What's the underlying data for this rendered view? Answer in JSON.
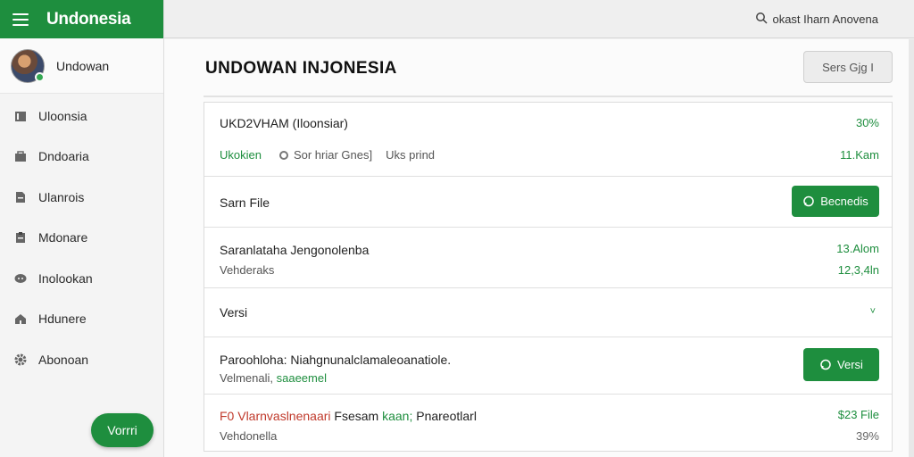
{
  "app": {
    "brand": "Undonesia"
  },
  "search": {
    "text": "okast Iharn  Anovena"
  },
  "profile": {
    "name": "Undowan"
  },
  "sidebar": {
    "items": [
      {
        "label": "Uloonsia",
        "icon": "folder-icon"
      },
      {
        "label": "Dndoaria",
        "icon": "briefcase-icon"
      },
      {
        "label": "Ulanrois",
        "icon": "file-icon"
      },
      {
        "label": "Mdonare",
        "icon": "clipboard-icon"
      },
      {
        "label": "Inolookan",
        "icon": "chat-icon"
      },
      {
        "label": "Hdunere",
        "icon": "home-icon"
      },
      {
        "label": "Abonoan",
        "icon": "gear-icon"
      }
    ],
    "fab_label": "Vorrri"
  },
  "main": {
    "title": "UNDOWAN INJONESIA",
    "top_button": "Sers  Gjg  I",
    "rows": {
      "r1": {
        "title": "UKD2VHAM (Iloonsiar)",
        "right_top": "30%",
        "meta1": "Ukokien",
        "meta2": "Sor hriar Gnes]",
        "meta3": "Uks prind",
        "right_bottom": "11.Kam"
      },
      "r2": {
        "title": "Sarn File",
        "button": "Becnedis"
      },
      "r3": {
        "title": "Saranlataha Jengonolenba",
        "sub": "Vehderaks",
        "right_top": "13.Alom",
        "right_bottom": "12,3,4ln"
      },
      "r4": {
        "title": "Versi",
        "chevron": "˅"
      },
      "r5": {
        "title": "Paroohloha: Niahgnunalclamaleoanatiole.",
        "sub_a": "Velmenali,",
        "sub_b": "saaeemel",
        "button": "Versi"
      },
      "r6": {
        "title_a": "F0 Vlarnvaslnenaari",
        "title_b": "Fsesam",
        "title_c": "kaan;",
        "title_d": "Pnareotlarl",
        "sub": "Vehdonella",
        "right_top": "$23 File",
        "right_bottom": "39%"
      }
    }
  },
  "colors": {
    "accent": "#1e8e3e",
    "alert": "#c0392b"
  }
}
